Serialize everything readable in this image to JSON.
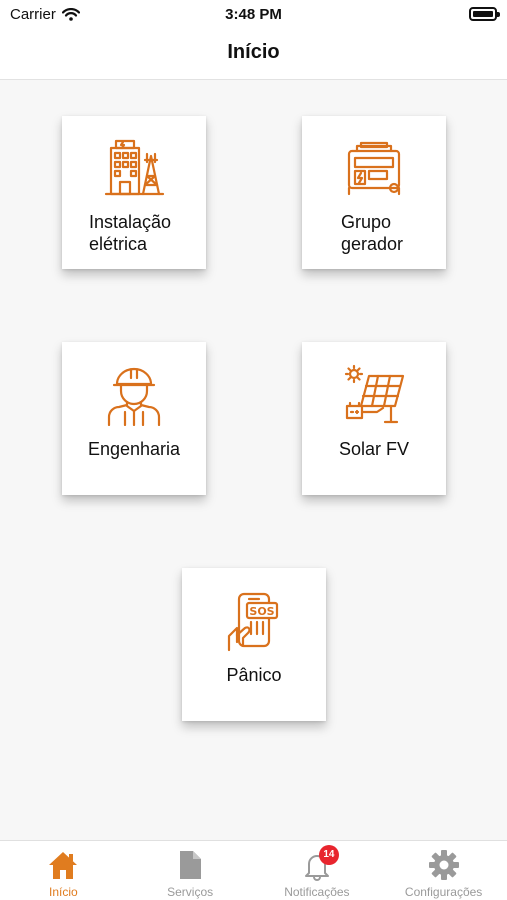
{
  "status_bar": {
    "carrier": "Carrier",
    "time": "3:48 PM"
  },
  "nav": {
    "title": "Início"
  },
  "cards": [
    {
      "label": "Instalação elétrica",
      "icon": "electrical-installation-icon"
    },
    {
      "label": "Grupo gerador",
      "icon": "generator-icon"
    },
    {
      "label": "Engenharia",
      "icon": "engineer-icon"
    },
    {
      "label": "Solar FV",
      "icon": "solar-panel-icon"
    },
    {
      "label": "Pânico",
      "icon": "sos-phone-icon"
    }
  ],
  "tabs": [
    {
      "label": "Início",
      "icon": "home-icon",
      "active": true
    },
    {
      "label": "Serviços",
      "icon": "document-icon"
    },
    {
      "label": "Notificações",
      "icon": "bell-icon",
      "badge": "14"
    },
    {
      "label": "Configurações",
      "icon": "gear-icon"
    }
  ],
  "colors": {
    "accent": "#e07c1f",
    "icon_orange": "#d9711c",
    "inactive": "#9a9a9a",
    "badge": "#e8252e"
  }
}
